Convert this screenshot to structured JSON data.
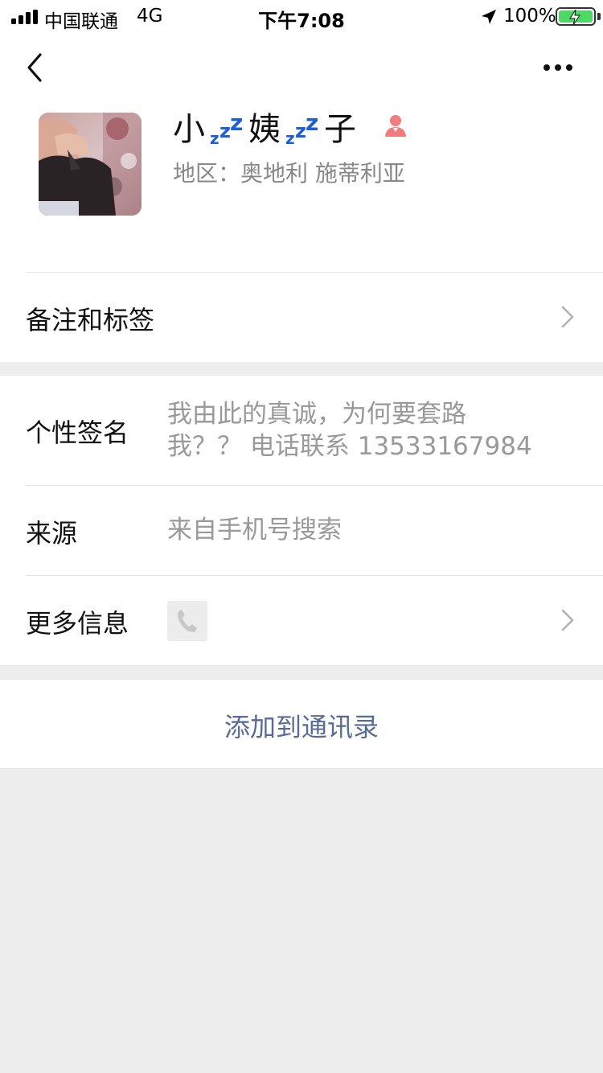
{
  "status_bar": {
    "carrier": "中国联通",
    "network": "4G",
    "time": "下午7:08",
    "battery": "100%"
  },
  "profile": {
    "nickname_part1": "小",
    "nickname_part2": "姨",
    "nickname_part3": "子",
    "zzz": "zzz",
    "region": "地区：奥地利 施蒂利亚",
    "gender_icon": "female-icon",
    "avatar_icon": "profile-avatar"
  },
  "remark_row": {
    "label": "备注和标签"
  },
  "signature_row": {
    "label": "个性签名",
    "value_line1": "我由此的真诚，为何要套路",
    "value_line2": "我？？ 电话联系 13533167984"
  },
  "source_row": {
    "label": "来源",
    "value": "来自手机号搜索"
  },
  "more_row": {
    "label": "更多信息",
    "icon": "phone-icon"
  },
  "add_contact": {
    "label": "添加到通讯录"
  },
  "colors": {
    "accent_link": "#576b95",
    "zzz_blue": "#1e5fd6",
    "female_pink": "#f47c7c",
    "battery_green": "#4cd964"
  }
}
